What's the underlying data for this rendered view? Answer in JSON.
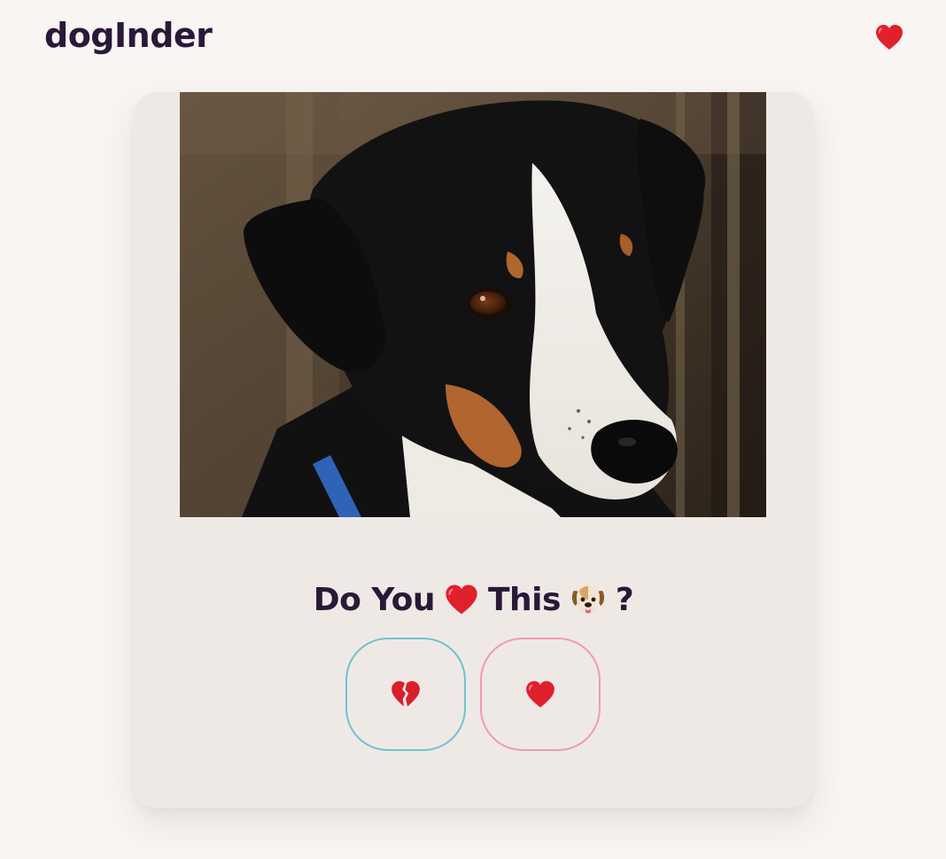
{
  "app": {
    "title": "dogInder"
  },
  "header": {
    "favorites_icon": "heart-icon"
  },
  "card": {
    "photo_alt": "dog photo",
    "question": {
      "prefix": "Do You",
      "middle": "This",
      "suffix": "?"
    },
    "buttons": [
      {
        "action": "dislike",
        "icon": "broken-heart-icon",
        "border_color": "#6fc3cc"
      },
      {
        "action": "like",
        "icon": "heart-icon",
        "border_color": "#ef9bb8"
      }
    ]
  },
  "colors": {
    "background": "#f9f5f3",
    "card": "#efe9e6",
    "text": "#2a1838",
    "heart": "#e0202c"
  }
}
